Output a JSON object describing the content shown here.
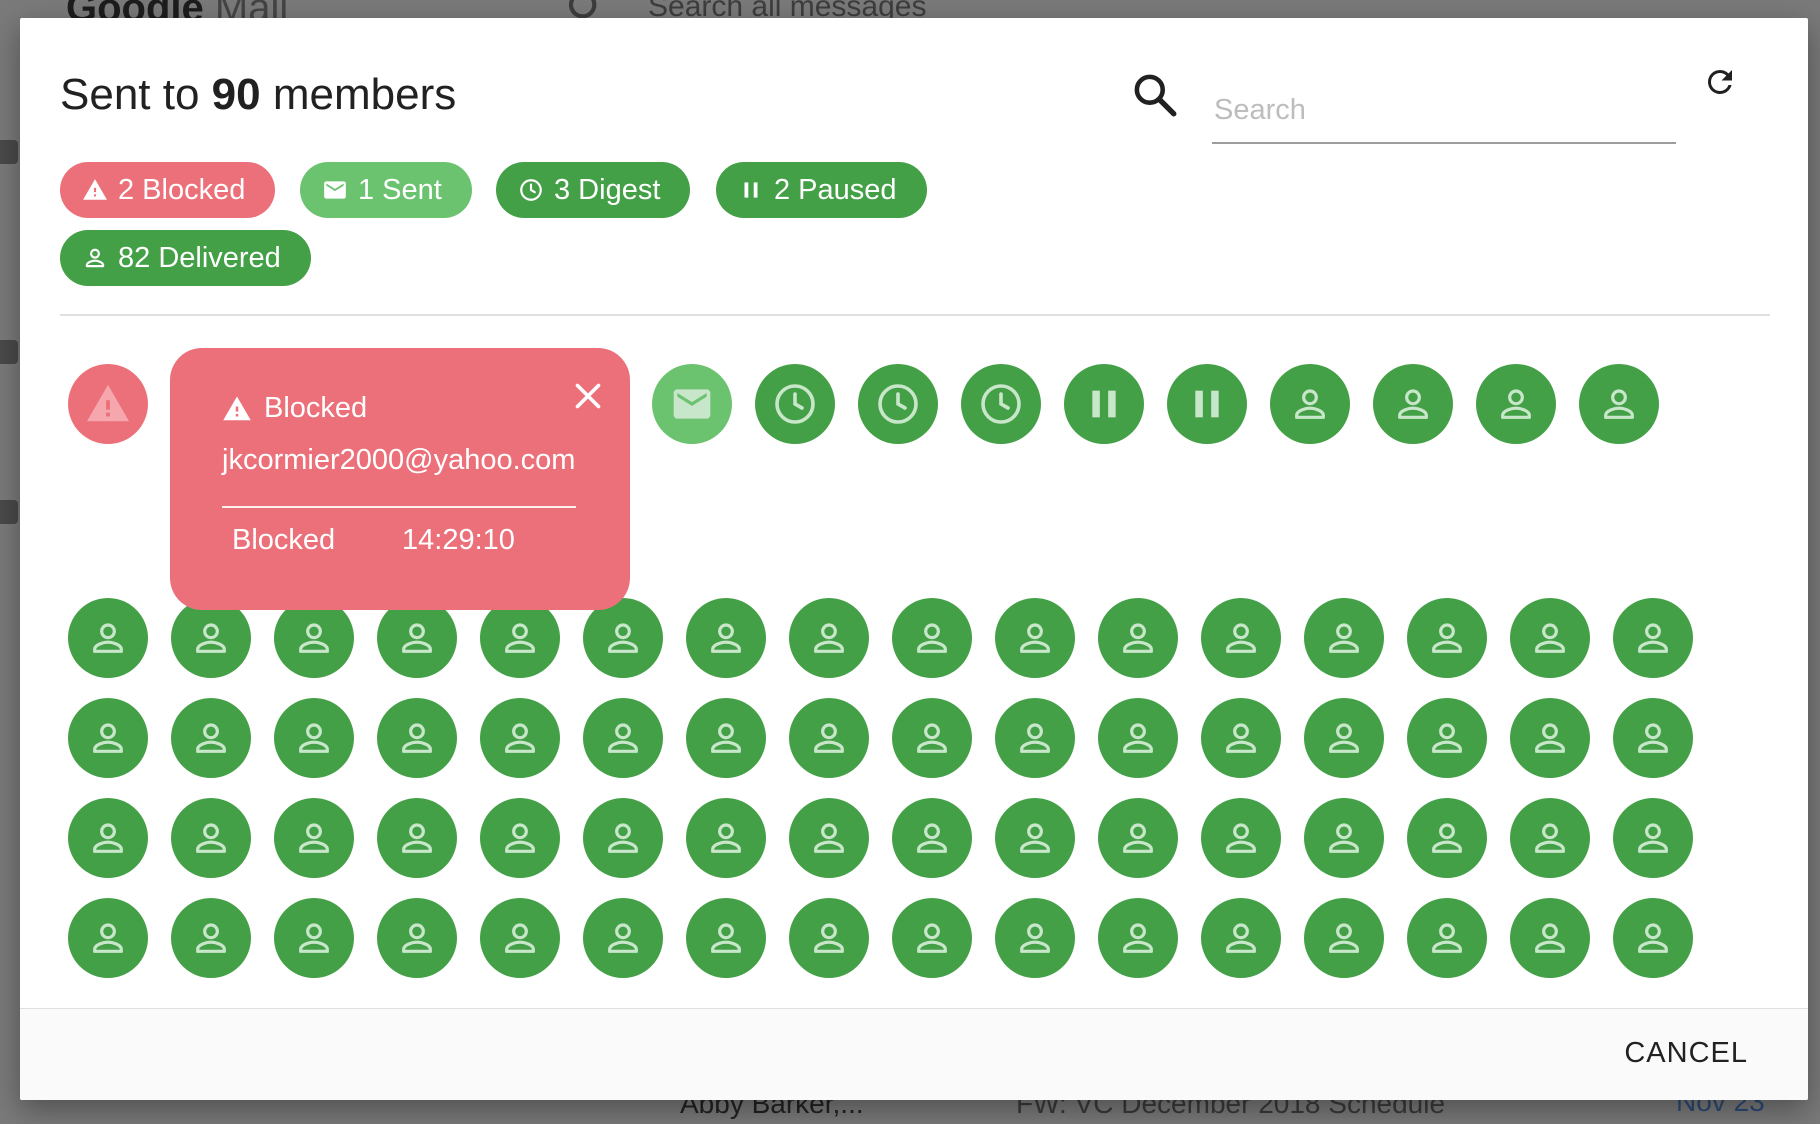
{
  "background": {
    "logo_bold": "Google",
    "logo_rest": " Mail",
    "search_placeholder": "Search all messages",
    "row_sender": "Abby Barker,...",
    "row_subject": "FW: VC December 2018 Schedule",
    "row_date": "Nov 23"
  },
  "dialog": {
    "title_prefix": "Sent to ",
    "title_count": "90",
    "title_suffix": " members",
    "search": {
      "placeholder": "Search",
      "value": ""
    },
    "chips": [
      {
        "label": "2 Blocked",
        "icon": "warning-icon",
        "color": "#ec7079"
      },
      {
        "label": "1 Sent",
        "icon": "envelope-icon",
        "color": "#6bc26f"
      },
      {
        "label": "3 Digest",
        "icon": "clock-icon",
        "color": "#43a047"
      },
      {
        "label": "2 Paused",
        "icon": "pause-icon",
        "color": "#43a047"
      },
      {
        "label": "82 Delivered",
        "icon": "person-icon",
        "color": "#43a047"
      }
    ],
    "popup": {
      "title": "Blocked",
      "email": "jkcormier2000@yahoo.com",
      "status": "Blocked",
      "time": "14:29:10"
    },
    "cancel_label": "CANCEL",
    "colors": {
      "blocked": "#ec7079",
      "sent": "#6bc26f",
      "delivered": "#43a047",
      "icon_light": "#c8e6c9"
    }
  }
}
